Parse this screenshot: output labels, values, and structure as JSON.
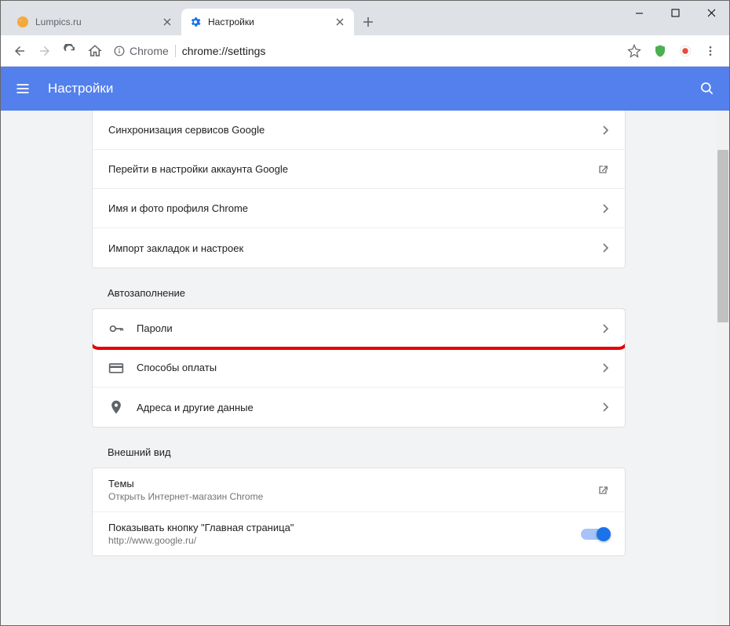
{
  "tabs": [
    {
      "label": "Lumpics.ru",
      "active": false
    },
    {
      "label": "Настройки",
      "active": true
    }
  ],
  "omnibox": {
    "prefix": "Chrome",
    "url": "chrome://settings"
  },
  "header": {
    "title": "Настройки"
  },
  "sections": {
    "sync": [
      {
        "label": "Синхронизация сервисов Google",
        "icon": "arrow"
      },
      {
        "label": "Перейти в настройки аккаунта Google",
        "icon": "external"
      },
      {
        "label": "Имя и фото профиля Chrome",
        "icon": "arrow"
      },
      {
        "label": "Импорт закладок и настроек",
        "icon": "arrow"
      }
    ],
    "autofill_title": "Автозаполнение",
    "autofill": [
      {
        "label": "Пароли",
        "icon_name": "key"
      },
      {
        "label": "Способы оплаты",
        "icon_name": "card"
      },
      {
        "label": "Адреса и другие данные",
        "icon_name": "pin"
      }
    ],
    "appearance_title": "Внешний вид",
    "appearance": [
      {
        "label": "Темы",
        "sub": "Открыть Интернет-магазин Chrome",
        "icon": "external"
      },
      {
        "label": "Показывать кнопку \"Главная страница\"",
        "sub": "http://www.google.ru/",
        "icon": "toggle"
      }
    ]
  }
}
